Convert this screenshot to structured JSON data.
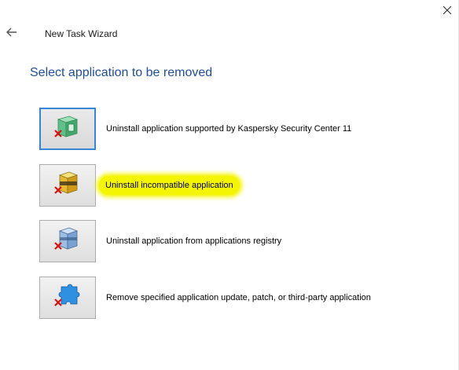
{
  "header": {
    "title": "New Task Wizard",
    "back_icon": "arrow-left-icon",
    "close_icon": "close-icon"
  },
  "page": {
    "heading": "Select application to be removed"
  },
  "options": [
    {
      "label": "Uninstall application supported by Kaspersky Security Center 11",
      "icon": "kaspersky-app-uninstall-icon",
      "selected": true
    },
    {
      "label": "Uninstall incompatible application",
      "icon": "incompatible-app-uninstall-icon",
      "highlighted": true
    },
    {
      "label": "Uninstall application from applications registry",
      "icon": "registry-app-uninstall-icon"
    },
    {
      "label": "Remove specified application update, patch, or third-party application",
      "icon": "update-patch-remove-icon"
    }
  ],
  "colors": {
    "heading": "#1f4e9c",
    "highlight": "#f4f500",
    "selected_border": "#3a86d6"
  }
}
